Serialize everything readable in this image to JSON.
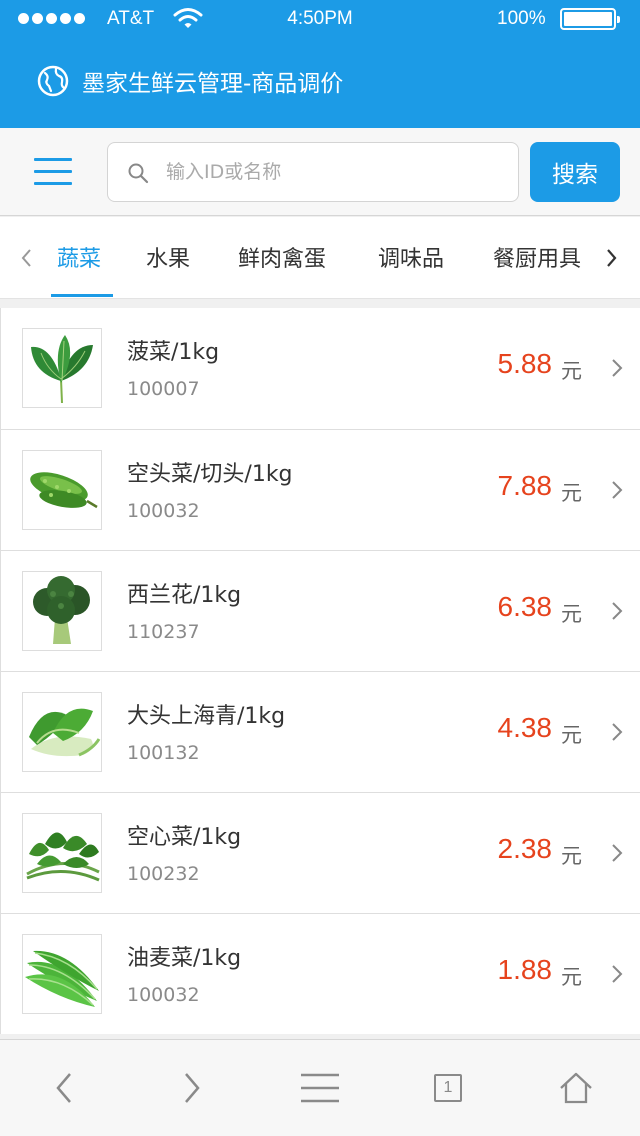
{
  "status_bar": {
    "carrier": "AT&T",
    "time": "4:50PM",
    "battery": "100%"
  },
  "app": {
    "title": "墨家生鲜云管理-商品调价",
    "icon": "globe-icon"
  },
  "search": {
    "placeholder": "输入ID或名称",
    "value": "",
    "button_label": "搜索"
  },
  "tabs": [
    {
      "label": "蔬菜",
      "active": true
    },
    {
      "label": "水果",
      "active": false
    },
    {
      "label": "鲜肉禽蛋",
      "active": false
    },
    {
      "label": "调味品",
      "active": false
    },
    {
      "label": "餐厨用具",
      "active": false
    }
  ],
  "products": [
    {
      "name": "菠菜/1kg",
      "id": "100007",
      "price": "5.88",
      "unit": "元"
    },
    {
      "name": "空头菜/切头/1kg",
      "id": "100032",
      "price": "7.88",
      "unit": "元"
    },
    {
      "name": "西兰花/1kg",
      "id": "110237",
      "price": "6.38",
      "unit": "元"
    },
    {
      "name": "大头上海青/1kg",
      "id": "100132",
      "price": "4.38",
      "unit": "元"
    },
    {
      "name": "空心菜/1kg",
      "id": "100232",
      "price": "2.38",
      "unit": "元"
    },
    {
      "name": "油麦菜/1kg",
      "id": "100032",
      "price": "1.88",
      "unit": "元"
    }
  ],
  "toolbar": {
    "page_count": "1"
  },
  "colors": {
    "accent": "#1c9be6",
    "price": "#e6431d",
    "background": "#f0f0f0"
  }
}
